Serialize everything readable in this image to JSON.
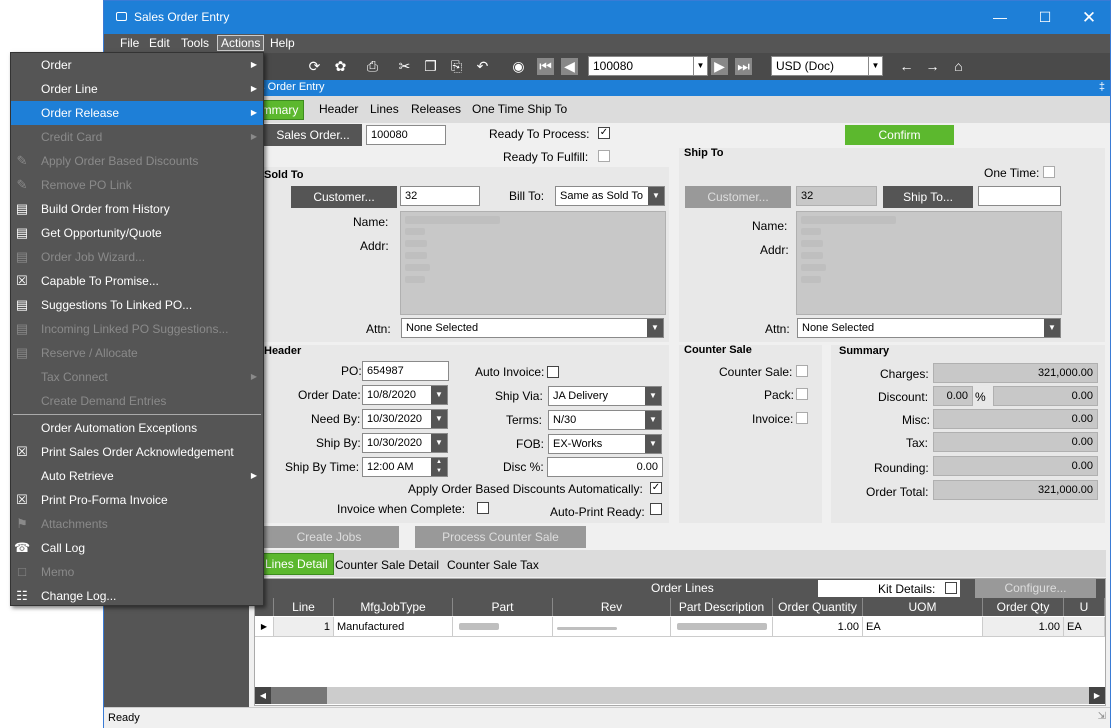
{
  "window": {
    "title": "Sales Order Entry"
  },
  "menubar": [
    "File",
    "Edit",
    "Tools",
    "Actions",
    "Help"
  ],
  "toolbar": {
    "order_number": "100080",
    "currency": "USD (Doc)"
  },
  "panel_header": "es Order Entry",
  "tabs": [
    "ummary",
    "Header",
    "Lines",
    "Releases",
    "One Time Ship To"
  ],
  "top": {
    "sales_order_btn": "Sales Order...",
    "sales_order_value": "100080",
    "ready_to_process": "Ready To Process:",
    "ready_to_fulfill": "Ready To Fulfill:",
    "confirm": "Confirm"
  },
  "sold_to": {
    "title": "Sold To",
    "customer_btn": "Customer...",
    "customer_value": "32",
    "bill_to_label": "Bill To:",
    "bill_to_value": "Same as Sold To",
    "name_label": "Name:",
    "addr_label": "Addr:",
    "attn_label": "Attn:",
    "attn_value": "None Selected"
  },
  "ship_to": {
    "title": "Ship To",
    "one_time": "One Time:",
    "customer_btn": "Customer...",
    "customer_value": "32",
    "ship_to_btn": "Ship To...",
    "name_label": "Name:",
    "addr_label": "Addr:",
    "attn_label": "Attn:",
    "attn_value": "None Selected"
  },
  "header": {
    "title": "Header",
    "po_label": "PO:",
    "po_value": "654987",
    "order_date_label": "Order Date:",
    "order_date": "10/8/2020",
    "need_by_label": "Need By:",
    "need_by": "10/30/2020",
    "ship_by_label": "Ship By:",
    "ship_by": "10/30/2020",
    "ship_by_time_label": "Ship By Time:",
    "ship_by_time": "12:00 AM",
    "auto_invoice": "Auto Invoice:",
    "ship_via_label": "Ship Via:",
    "ship_via": "JA Delivery",
    "terms_label": "Terms:",
    "terms": "N/30",
    "fob_label": "FOB:",
    "fob": "EX-Works",
    "disc_label": "Disc %:",
    "disc": "0.00",
    "apply_discounts": "Apply Order Based Discounts Automatically:",
    "invoice_complete": "Invoice when Complete:",
    "auto_print": "Auto-Print Ready:"
  },
  "counter_sale": {
    "title": "Counter Sale",
    "counter_sale": "Counter Sale:",
    "pack": "Pack:",
    "invoice": "Invoice:"
  },
  "summary": {
    "title": "Summary",
    "charges_label": "Charges:",
    "charges": "321,000.00",
    "discount_label": "Discount:",
    "discount_pct": "0.00",
    "pct": "%",
    "discount": "0.00",
    "misc_label": "Misc:",
    "misc": "0.00",
    "tax_label": "Tax:",
    "tax": "0.00",
    "rounding_label": "Rounding:",
    "rounding": "0.00",
    "total_label": "Order Total:",
    "total": "321,000.00"
  },
  "buttons": {
    "create_jobs": "Create Jobs",
    "process_counter": "Process Counter Sale"
  },
  "lower_tabs": [
    "Lines Detail",
    "Counter Sale Detail",
    "Counter Sale Tax"
  ],
  "grid": {
    "title": "Order Lines",
    "kit_details": "Kit Details:",
    "configure": "Configure...",
    "columns": [
      "Line",
      "MfgJobType",
      "Part",
      "Rev",
      "Part Description",
      "Order Quantity",
      "UOM",
      "Order Qty",
      "U"
    ],
    "row": {
      "line": "1",
      "type": "Manufactured",
      "qty": "1.00",
      "uom": "EA",
      "oqty": "1.00",
      "ou": "EA"
    }
  },
  "status": "Ready",
  "menu": [
    {
      "label": "Order",
      "arrow": true,
      "state": "normal"
    },
    {
      "label": "Order Line",
      "arrow": true,
      "state": "normal"
    },
    {
      "label": "Order Release",
      "arrow": true,
      "state": "selected"
    },
    {
      "label": "Credit Card",
      "arrow": true,
      "state": "disabled"
    },
    {
      "label": "Apply Order Based Discounts",
      "icon": "discount-icon",
      "state": "disabled"
    },
    {
      "label": "Remove PO Link",
      "icon": "unlink-icon",
      "state": "disabled"
    },
    {
      "label": "Build Order from History",
      "icon": "window-icon",
      "state": "normal"
    },
    {
      "label": "Get Opportunity/Quote",
      "icon": "window-icon",
      "state": "normal"
    },
    {
      "label": "Order Job Wizard...",
      "icon": "window-icon",
      "state": "disabled"
    },
    {
      "label": "Capable To Promise...",
      "icon": "calendar-icon",
      "state": "normal"
    },
    {
      "label": "Suggestions To Linked PO...",
      "icon": "window-icon",
      "state": "normal"
    },
    {
      "label": "Incoming Linked PO Suggestions...",
      "icon": "window-icon",
      "state": "disabled"
    },
    {
      "label": "Reserve / Allocate",
      "icon": "window-icon",
      "state": "disabled"
    },
    {
      "label": "Tax Connect",
      "arrow": true,
      "state": "disabled"
    },
    {
      "label": "Create Demand Entries",
      "state": "disabled"
    },
    {
      "label": "Order Automation Exceptions",
      "state": "normal"
    },
    {
      "label": "Print Sales Order Acknowledgement",
      "icon": "print-form-icon",
      "state": "normal"
    },
    {
      "label": "Auto Retrieve",
      "arrow": true,
      "state": "normal"
    },
    {
      "label": "Print Pro-Forma Invoice",
      "icon": "print-form-icon",
      "state": "normal"
    },
    {
      "label": "Attachments",
      "icon": "attachment-icon",
      "state": "disabled"
    },
    {
      "label": "Call Log",
      "icon": "phone-icon",
      "state": "normal"
    },
    {
      "label": "Memo",
      "icon": "memo-icon",
      "state": "disabled"
    },
    {
      "label": "Change Log...",
      "icon": "book-icon",
      "state": "normal"
    }
  ]
}
